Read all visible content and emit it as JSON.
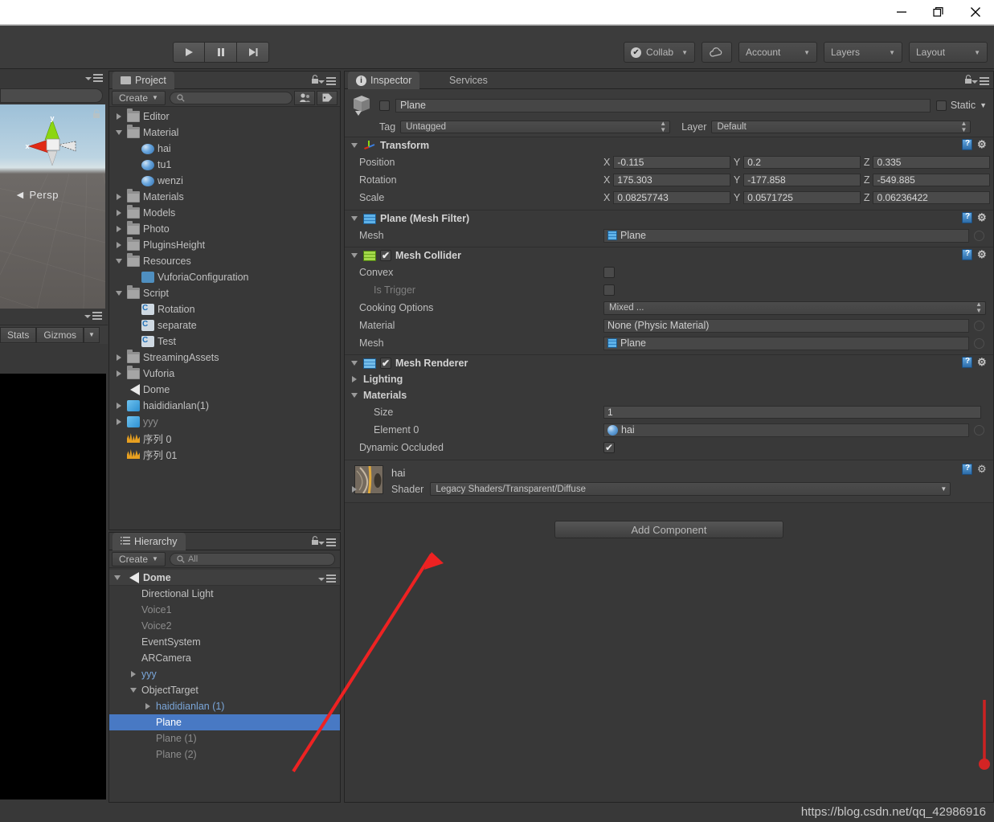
{
  "window": {
    "buttons": [
      {
        "name": "minimize",
        "glyph": "minimize-icon"
      },
      {
        "name": "maximize",
        "glyph": "maximize-icon"
      },
      {
        "name": "close",
        "glyph": "close-icon"
      }
    ]
  },
  "toolbar": {
    "play": "play-icon",
    "pause": "pause-icon",
    "step": "step-icon",
    "collab_label": "Collab",
    "cloud_label": "cloud-icon",
    "account_label": "Account",
    "layers_label": "Layers",
    "layout_label": "Layout"
  },
  "scene": {
    "persp_label": "Persp",
    "axis_x": "x",
    "axis_y": "y",
    "stats_label": "Stats",
    "gizmos_label": "Gizmos"
  },
  "project": {
    "tab_label": "Project",
    "create_label": "Create",
    "search_placeholder": "",
    "items": [
      {
        "label": "Editor",
        "indent": 0,
        "arrow": "right",
        "icon": "folder-icon",
        "style": ""
      },
      {
        "label": "Material",
        "indent": 0,
        "arrow": "down",
        "icon": "folder-icon",
        "style": ""
      },
      {
        "label": "hai",
        "indent": 1,
        "arrow": "none",
        "icon": "material-icon",
        "style": ""
      },
      {
        "label": "tu1",
        "indent": 1,
        "arrow": "none",
        "icon": "material-icon",
        "style": ""
      },
      {
        "label": "wenzi",
        "indent": 1,
        "arrow": "none",
        "icon": "material-icon",
        "style": ""
      },
      {
        "label": "Materials",
        "indent": 0,
        "arrow": "right",
        "icon": "folder-icon",
        "style": ""
      },
      {
        "label": "Models",
        "indent": 0,
        "arrow": "right",
        "icon": "folder-icon",
        "style": ""
      },
      {
        "label": "Photo",
        "indent": 0,
        "arrow": "right",
        "icon": "folder-icon",
        "style": ""
      },
      {
        "label": "PluginsHeight",
        "indent": 0,
        "arrow": "right",
        "icon": "folder-icon",
        "style": ""
      },
      {
        "label": "Resources",
        "indent": 0,
        "arrow": "down",
        "icon": "folder-icon",
        "style": ""
      },
      {
        "label": "VuforiaConfiguration",
        "indent": 1,
        "arrow": "none",
        "icon": "vuforia-icon",
        "style": ""
      },
      {
        "label": "Script",
        "indent": 0,
        "arrow": "down",
        "icon": "folder-icon",
        "style": ""
      },
      {
        "label": "Rotation",
        "indent": 1,
        "arrow": "none",
        "icon": "script-icon",
        "style": ""
      },
      {
        "label": "separate",
        "indent": 1,
        "arrow": "none",
        "icon": "script-icon",
        "style": ""
      },
      {
        "label": "Test",
        "indent": 1,
        "arrow": "none",
        "icon": "script-icon",
        "style": ""
      },
      {
        "label": "StreamingAssets",
        "indent": 0,
        "arrow": "right",
        "icon": "folder-icon",
        "style": ""
      },
      {
        "label": "Vuforia",
        "indent": 0,
        "arrow": "right",
        "icon": "folder-icon",
        "style": ""
      },
      {
        "label": "Dome",
        "indent": 0,
        "arrow": "none",
        "icon": "scene-icon",
        "style": ""
      },
      {
        "label": "haididianlan(1)",
        "indent": 0,
        "arrow": "right",
        "icon": "prefab-icon",
        "style": ""
      },
      {
        "label": "yyy",
        "indent": 0,
        "arrow": "right",
        "icon": "prefab-icon",
        "style": "dim"
      },
      {
        "label": "序列 0",
        "indent": 0,
        "arrow": "none",
        "icon": "audio-icon",
        "style": ""
      },
      {
        "label": "序列 01",
        "indent": 0,
        "arrow": "none",
        "icon": "audio-icon",
        "style": ""
      }
    ]
  },
  "hierarchy": {
    "tab_label": "Hierarchy",
    "create_label": "Create",
    "search_placeholder": "All",
    "scene_name": "Dome",
    "items": [
      {
        "label": "Directional Light",
        "indent": 1,
        "arrow": "none",
        "style": ""
      },
      {
        "label": "Voice1",
        "indent": 1,
        "arrow": "none",
        "style": "dim"
      },
      {
        "label": "Voice2",
        "indent": 1,
        "arrow": "none",
        "style": "dim"
      },
      {
        "label": "EventSystem",
        "indent": 1,
        "arrow": "none",
        "style": ""
      },
      {
        "label": "ARCamera",
        "indent": 1,
        "arrow": "none",
        "style": ""
      },
      {
        "label": "yyy",
        "indent": 1,
        "arrow": "right",
        "style": "blue"
      },
      {
        "label": "ObjectTarget",
        "indent": 1,
        "arrow": "down",
        "style": ""
      },
      {
        "label": "haididianlan (1)",
        "indent": 2,
        "arrow": "right",
        "style": "blue"
      },
      {
        "label": "Plane",
        "indent": 2,
        "arrow": "none",
        "style": "sel"
      },
      {
        "label": "Plane (1)",
        "indent": 2,
        "arrow": "none",
        "style": "dim"
      },
      {
        "label": "Plane (2)",
        "indent": 2,
        "arrow": "none",
        "style": "dim"
      }
    ]
  },
  "inspector": {
    "tabs": [
      {
        "label": "Inspector",
        "active": true
      },
      {
        "label": "Services",
        "active": false
      }
    ],
    "object_name": "Plane",
    "static_label": "Static",
    "tag_label": "Tag",
    "tag_value": "Untagged",
    "layer_label": "Layer",
    "layer_value": "Default",
    "transform": {
      "title": "Transform",
      "rows": [
        {
          "label": "Position",
          "x": "-0.115",
          "y": "0.2",
          "z": "0.335"
        },
        {
          "label": "Rotation",
          "x": "175.303",
          "y": "-177.858",
          "z": "-549.885"
        },
        {
          "label": "Scale",
          "x": "0.08257743",
          "y": "0.0571725",
          "z": "0.06236422"
        }
      ],
      "axis_x": "X",
      "axis_y": "Y",
      "axis_z": "Z"
    },
    "mesh_filter": {
      "title": "Plane (Mesh Filter)",
      "mesh_label": "Mesh",
      "mesh_value": "Plane"
    },
    "mesh_collider": {
      "title": "Mesh Collider",
      "enabled": true,
      "convex_label": "Convex",
      "convex_checked": false,
      "is_trigger_label": "Is Trigger",
      "is_trigger_checked": false,
      "cooking_label": "Cooking Options",
      "cooking_value": "Mixed ...",
      "material_label": "Material",
      "material_value": "None (Physic Material)",
      "mesh_label": "Mesh",
      "mesh_value": "Plane"
    },
    "mesh_renderer": {
      "title": "Mesh Renderer",
      "enabled": true,
      "lighting_label": "Lighting",
      "materials_label": "Materials",
      "size_label": "Size",
      "size_value": "1",
      "element0_label": "Element 0",
      "element0_value": "hai",
      "dynamic_occluded_label": "Dynamic Occluded",
      "dynamic_occluded_checked": true
    },
    "material": {
      "name": "hai",
      "shader_label": "Shader",
      "shader_value": "Legacy Shaders/Transparent/Diffuse"
    },
    "add_component_label": "Add Component"
  },
  "watermark": "https://blog.csdn.net/qq_42986916",
  "colors": {
    "selection_blue": "#4879c4",
    "link_blue": "#7aa6d9",
    "annotation_red": "#ee2222",
    "panel_bg": "#383838",
    "header_bg": "#3b3b3b"
  }
}
